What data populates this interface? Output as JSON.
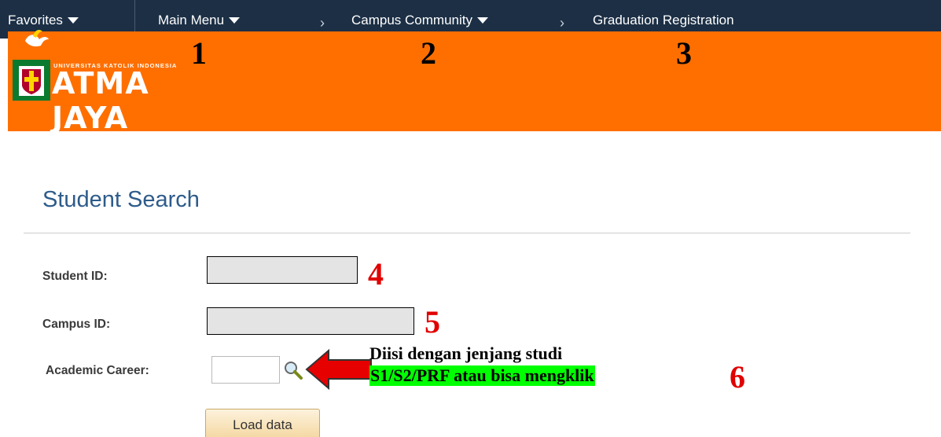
{
  "nav": {
    "favorites": "Favorites",
    "main_menu": "Main Menu",
    "campus_community": "Campus Community",
    "graduation_registration": "Graduation Registration",
    "separator": "›"
  },
  "banner": {
    "brand_small": "UNIVERSITAS KATOLIK INDONESIA",
    "brand_big": "ATMA JAYA",
    "color": "#ff6f00"
  },
  "annotations": {
    "n1": "1",
    "n2": "2",
    "n3": "3",
    "n4": "4",
    "n5": "5",
    "n6": "6",
    "note_line1": "Diisi dengan jenjang studi",
    "note_line2": "S1/S2/PRF atau bisa mengklik"
  },
  "form": {
    "title": "Student Search",
    "student_id_label": "Student ID:",
    "campus_id_label": "Campus ID:",
    "academic_career_label": "Academic Career:",
    "student_id_value": "",
    "campus_id_value": "",
    "academic_career_value": "",
    "load_button": "Load data"
  },
  "colors": {
    "nav_bg": "#1c2f45",
    "title": "#2e5b8a",
    "highlight": "#00ff00",
    "annotation_red": "#e10000"
  }
}
